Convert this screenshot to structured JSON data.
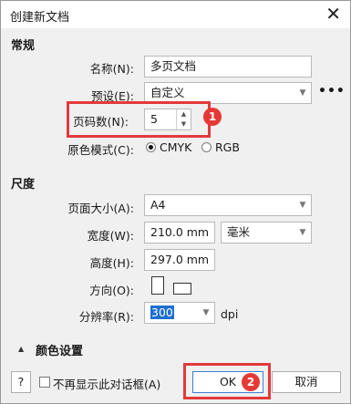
{
  "window": {
    "title": "创建新文档",
    "close_glyph": "✕"
  },
  "general": {
    "heading": "常规",
    "name_label": "名称(N):",
    "name_value": "多页文档",
    "preset_label": "预设(E):",
    "preset_value": "自定义",
    "more_glyph": "•••",
    "pages_label": "页码数(N):",
    "pages_value": "5",
    "colormode_label": "原色模式(C):",
    "cmyk_label": "CMYK",
    "rgb_label": "RGB",
    "selected_mode": "CMYK"
  },
  "size": {
    "heading": "尺度",
    "pagesize_label": "页面大小(A):",
    "pagesize_value": "A4",
    "width_label": "宽度(W):",
    "width_value": "210.0 mm",
    "unit_value": "毫米",
    "height_label": "高度(H):",
    "height_value": "297.0 mm",
    "orientation_label": "方向(O):",
    "resolution_label": "分辨率(R):",
    "resolution_value": "300",
    "resolution_unit": "dpi"
  },
  "color": {
    "heading": "颜色设置",
    "collapse_glyph": "▲"
  },
  "footer": {
    "help_label": "?",
    "dont_show_label": "不再显示此对话框(A)",
    "ok_label": "OK",
    "cancel_label": "取消"
  },
  "annotations": {
    "badge1": "1",
    "badge2": "2",
    "color": "#e53935"
  },
  "glyphs": {
    "arrow_down": "▼",
    "spin_up": "▲",
    "spin_down": "▼"
  }
}
